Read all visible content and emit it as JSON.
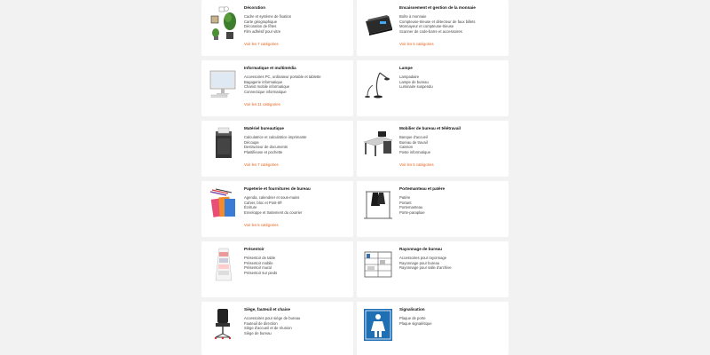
{
  "categories": [
    {
      "title": "Décoration",
      "items": [
        "Cadre et système de fixation",
        "Carte géographique",
        "Décoration de fêtes",
        "Film adhésif pour vitre"
      ],
      "link": "Voir les 7 catégories",
      "icon": "plant-frame-icon"
    },
    {
      "title": "Encaissement et gestion de la monnaie",
      "items": [
        "Boîte à monnaie",
        "Compteuse-trieuse et détecteur de faux billets",
        "Monnayeur et compteuse-trieuse",
        "Scanner de code-barre et accessoires"
      ],
      "link": "Voir les 5 catégories",
      "icon": "cash-counter-icon"
    },
    {
      "title": "Informatique et multimédia",
      "items": [
        "Accessoires PC, ordinateur portable et tablette",
        "Bagagerie informatique",
        "Chariot mobile informatique",
        "Connectique informatique"
      ],
      "link": "Voir les 11 catégories",
      "icon": "computer-icon"
    },
    {
      "title": "Lampe",
      "items": [
        "Lampadaire",
        "Lampe de bureau",
        "Luminaire suspendu"
      ],
      "link": "",
      "icon": "desk-lamp-icon"
    },
    {
      "title": "Matériel bureautique",
      "items": [
        "Calculatrice et calculatrice imprimante",
        "Découpe",
        "Destructeur de documents",
        "Plastifieuse et pochette"
      ],
      "link": "Voir les 7 catégories",
      "icon": "shredder-icon"
    },
    {
      "title": "Mobilier de bureau et télétravail",
      "items": [
        "Banque d'accueil",
        "Bureau de travail",
        "Caisson",
        "Poste informatique"
      ],
      "link": "Voir les 5 catégories",
      "icon": "desk-icon"
    },
    {
      "title": "Papeterie et fournitures de bureau",
      "items": [
        "Agenda, calendrier et sous-mains",
        "Cahier, bloc et Post-it®",
        "Écriture",
        "Enveloppe et traitement du courrier"
      ],
      "link": "Voir les 5 catégories",
      "icon": "stationery-icon"
    },
    {
      "title": "Portemanteau et patère",
      "items": [
        "Patère",
        "Portant",
        "Portemanteau",
        "Porte-parapluie"
      ],
      "link": "",
      "icon": "coat-rack-icon"
    },
    {
      "title": "Présentoir",
      "items": [
        "Présentoir de table",
        "Présentoir mobile",
        "Présentoir mural",
        "Présentoir sur pieds"
      ],
      "link": "",
      "icon": "display-stand-icon"
    },
    {
      "title": "Rayonnage de bureau",
      "items": [
        "Accessoires pour rayonnage",
        "Rayonnage pour bureau",
        "Rayonnage pour salle d'archive"
      ],
      "link": "",
      "icon": "shelving-icon"
    },
    {
      "title": "Siège, fauteuil et chaise",
      "items": [
        "Accessoires pour siège de bureau",
        "Fauteuil de direction",
        "Siège d'accueil et de réunion",
        "Siège de bureau"
      ],
      "link": "",
      "icon": "office-chair-icon"
    },
    {
      "title": "Signalisation",
      "items": [
        "Plaque de porte",
        "Plaque signalétique"
      ],
      "link": "",
      "icon": "sign-icon"
    }
  ]
}
